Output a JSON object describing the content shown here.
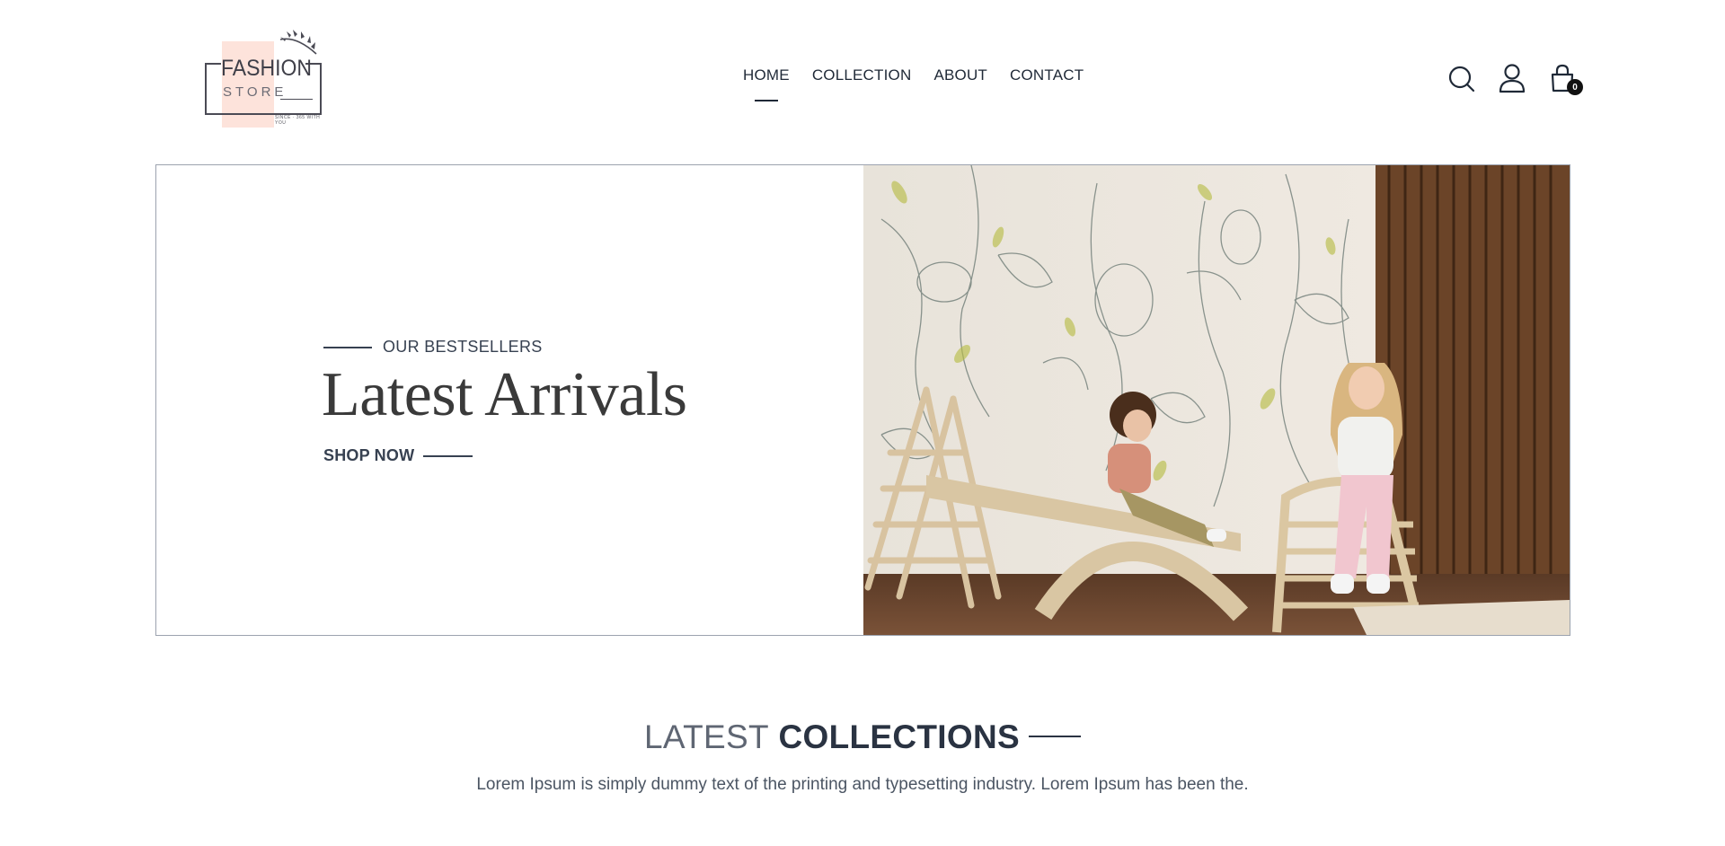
{
  "logo": {
    "brand": "FASHION",
    "sub": "STORE",
    "tagline": "SINCE · 365 WITH YOU"
  },
  "nav": {
    "items": [
      {
        "label": "HOME",
        "active": true
      },
      {
        "label": "COLLECTION",
        "active": false
      },
      {
        "label": "ABOUT",
        "active": false
      },
      {
        "label": "CONTACT",
        "active": false
      }
    ]
  },
  "header_icons": {
    "search": "search-icon",
    "account": "user-icon",
    "cart": "shopping-bag-icon",
    "cart_count": "0"
  },
  "hero": {
    "eyebrow": "OUR BESTSELLERS",
    "title": "Latest Arrivals",
    "cta": "SHOP NOW"
  },
  "collections": {
    "title_light": "LATEST",
    "title_bold": "COLLECTIONS",
    "description": "Lorem Ipsum is simply dummy text of the printing and typesetting industry. Lorem Ipsum has been the."
  },
  "colors": {
    "text_dark": "#1f2937",
    "logo_pink": "#fde3db",
    "border": "#9ca3af"
  }
}
